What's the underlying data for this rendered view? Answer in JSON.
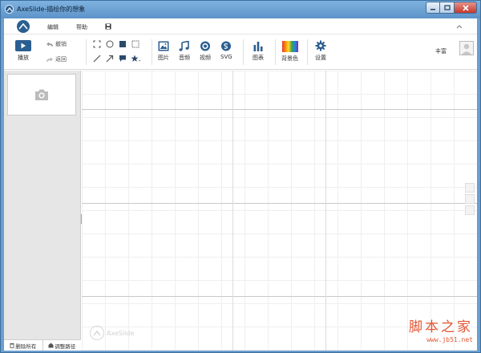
{
  "window": {
    "title": "AxeSlide-描绘你的想象"
  },
  "menu": {
    "edit": "编辑",
    "help": "帮助"
  },
  "toolbar": {
    "play": "播放",
    "undo": "撤销",
    "redo": "返回",
    "picture": "图片",
    "music": "音频",
    "video": "视频",
    "svg": "SVG",
    "chart": "图表",
    "background": "背景色",
    "settings": "设置"
  },
  "user": {
    "name": "丰富"
  },
  "left_panel": {
    "delete_all": "删除所有",
    "adjust_path": "调整路径"
  },
  "canvas": {
    "watermark": "AxeSlide"
  },
  "site": {
    "title": "脚本之家",
    "url": "www.jb51.net"
  },
  "colors": {
    "accent": "#2b5e90",
    "titlebar": "#6a9fd0",
    "site_mark": "#e25532"
  },
  "icons": [
    "app-icon",
    "logo-icon",
    "save-icon",
    "collapse-icon",
    "play-icon",
    "undo-icon",
    "redo-icon",
    "frame-icon",
    "circle-icon",
    "square-icon",
    "dashed-rect-icon",
    "line-icon",
    "arrow-icon",
    "speech-bubble-icon",
    "star-icon",
    "picture-icon",
    "music-icon",
    "video-icon",
    "svg-icon",
    "chart-icon",
    "palette-icon",
    "gear-icon",
    "avatar-icon",
    "camera-icon",
    "trash-icon",
    "path-icon"
  ]
}
